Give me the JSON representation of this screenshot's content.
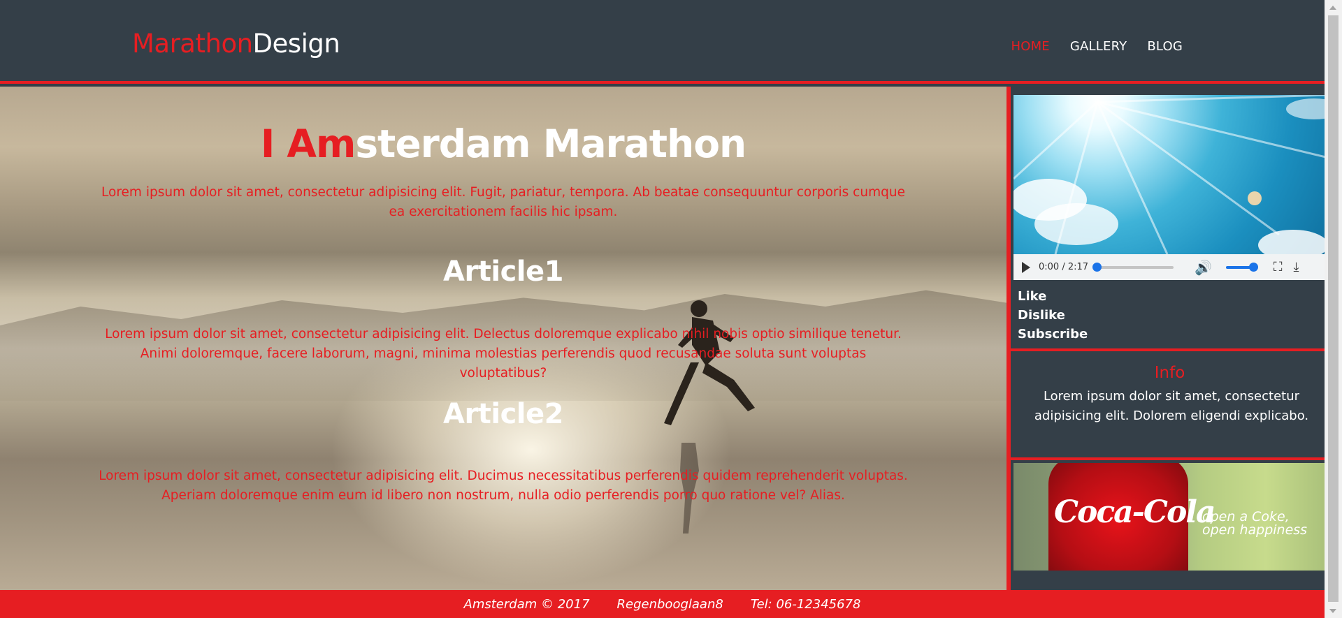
{
  "header": {
    "logo_part1": "Marathon",
    "logo_part2": "Design",
    "nav": [
      {
        "label": "HOME",
        "active": true
      },
      {
        "label": "GALLERY",
        "active": false
      },
      {
        "label": "BLOG",
        "active": false
      }
    ]
  },
  "main": {
    "title_part1": "I Am",
    "title_part2": "sterdam Marathon",
    "intro": "Lorem ipsum dolor sit amet, consectetur adipisicing elit. Fugit, pariatur, tempora. Ab beatae consequuntur corporis cumque ea exercitationem facilis hic ipsam.",
    "articles": [
      {
        "title": "Article1",
        "text": "Lorem ipsum dolor sit amet, consectetur adipisicing elit. Delectus doloremque explicabo nihil nobis optio similique tenetur. Animi doloremque, facere laborum, magni, minima molestias perferendis quod recusandae soluta sunt voluptas voluptatibus?"
      },
      {
        "title": "Article2",
        "text": "Lorem ipsum dolor sit amet, consectetur adipisicing elit. Ducimus necessitatibus perferendis quidem reprehenderit voluptas. Aperiam doloremque enim eum id libero non nostrum, nulla odio perferendis porro quo ratione vel? Alias."
      }
    ]
  },
  "sidebar": {
    "video": {
      "time": "0:00 / 2:17",
      "progress": 0,
      "volume": 1,
      "icons": {
        "play": "play-icon",
        "volume": "volume-icon",
        "fullscreen": "fullscreen-icon",
        "download": "download-icon"
      }
    },
    "social": [
      "Like",
      "Dislike",
      "Subscribe"
    ],
    "info": {
      "title": "Info",
      "text": "Lorem ipsum dolor sit amet, consectetur adipisicing elit. Dolorem eligendi explicabo."
    },
    "ad": {
      "logo_text": "Coca-Cola",
      "slogan_line1": "open a Coke,",
      "slogan_line2": "open happiness"
    }
  },
  "footer": {
    "city": "Amsterdam © 2017",
    "address": "Regenbooglaan8",
    "phone": "Tel: 06-12345678"
  },
  "colors": {
    "accent": "#e61e22",
    "background": "#343f48",
    "text_light": "#ffffff"
  }
}
